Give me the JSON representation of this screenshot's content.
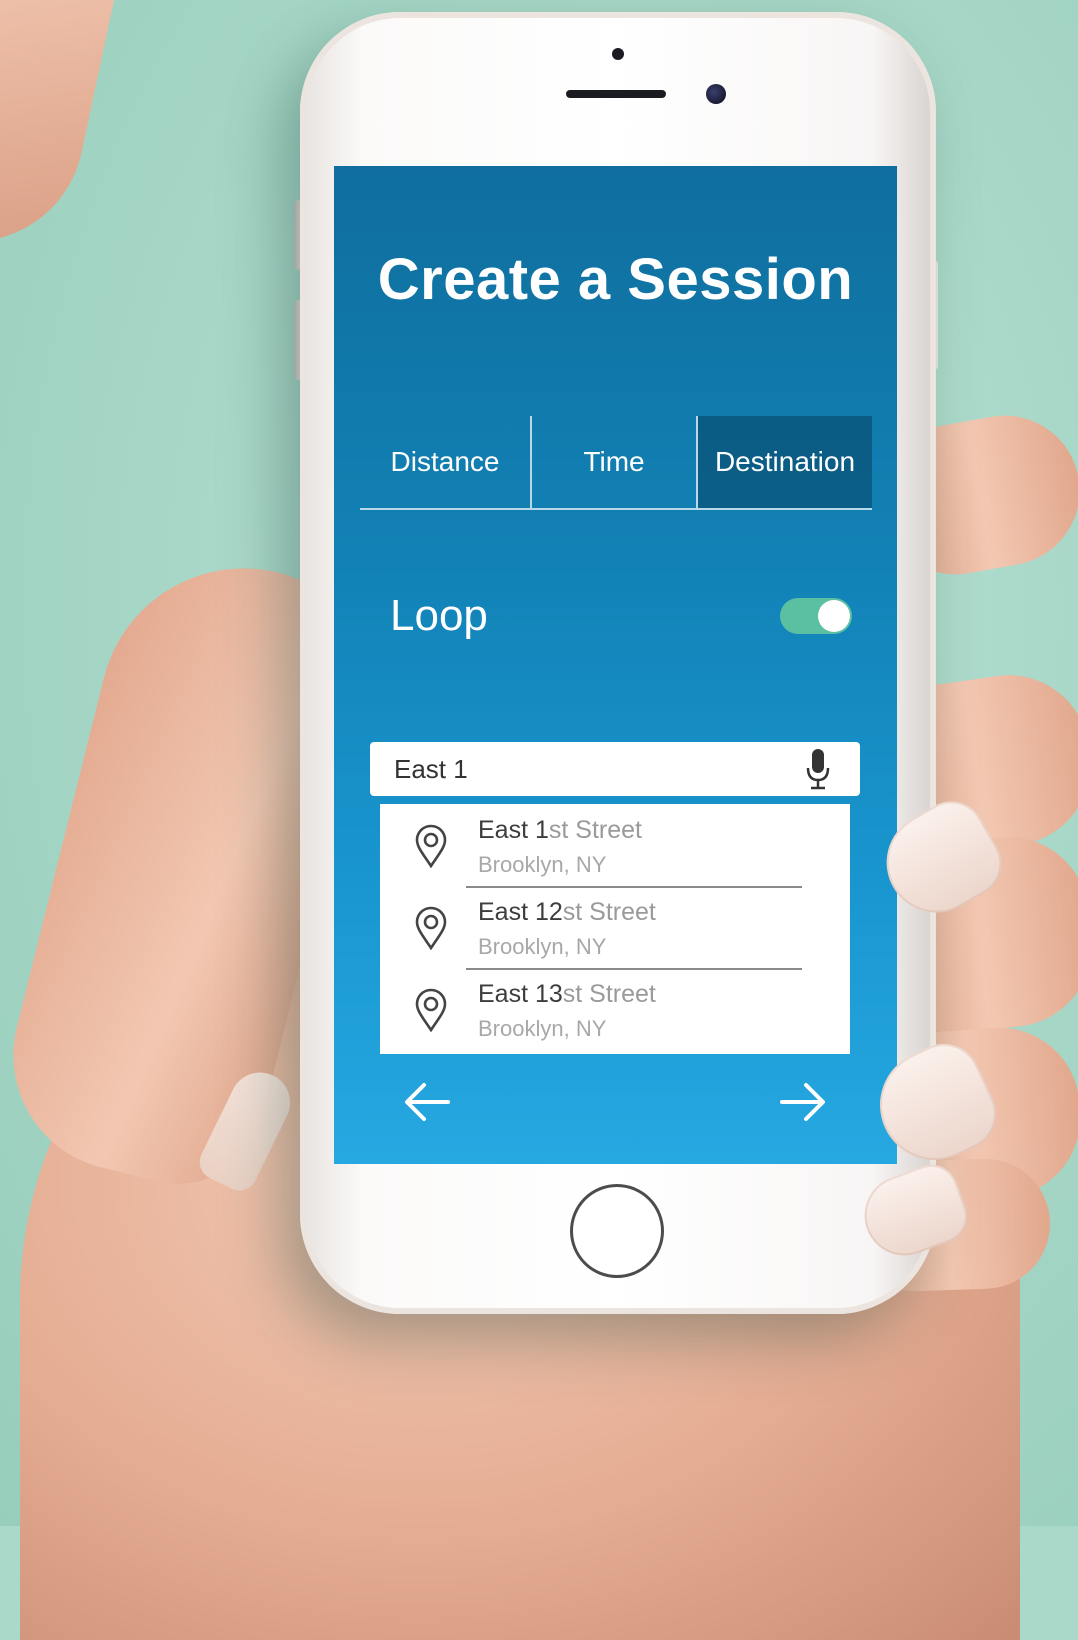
{
  "screen": {
    "title": "Create a Session",
    "tabs": [
      {
        "label": "Distance",
        "active": false
      },
      {
        "label": "Time",
        "active": false
      },
      {
        "label": "Destination",
        "active": true
      }
    ],
    "loop": {
      "label": "Loop",
      "enabled": true
    },
    "search": {
      "value": "East 1",
      "placeholder": ""
    },
    "suggestions": [
      {
        "match": "East 1",
        "rest": "st Street",
        "city": "Brooklyn, NY"
      },
      {
        "match": "East 12",
        "rest": "st Street",
        "city": "Brooklyn, NY"
      },
      {
        "match": "East 13",
        "rest": "st Street",
        "city": "Brooklyn, NY"
      }
    ]
  },
  "colors": {
    "background": "#a9d9c9",
    "screen_top": "#0f6e9d",
    "screen_bottom": "#27a8e1",
    "toggle_on": "#5bc0a2",
    "active_tab": "#0b4a6e"
  },
  "icons": [
    "map-pin-icon",
    "microphone-icon",
    "arrow-left-icon",
    "arrow-right-icon"
  ]
}
